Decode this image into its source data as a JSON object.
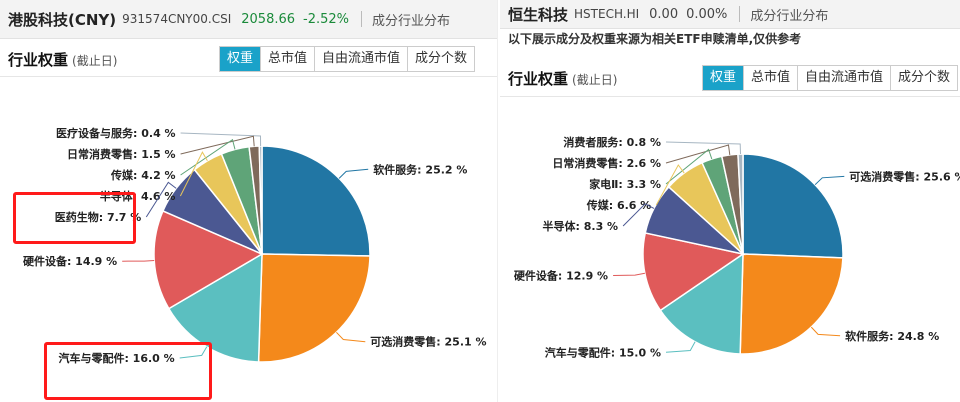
{
  "colors": {
    "palette": [
      "#2176a4",
      "#f4891b",
      "#5bbfc0",
      "#e05a5a",
      "#4b5892",
      "#e8c65a",
      "#5fa478",
      "#7f6a5b",
      "#a7b6c2"
    ],
    "active_tab": "#1aa2c9",
    "highlight": "#ff1a1a"
  },
  "left": {
    "index_name": "港股科技(CNY)",
    "index_code": "931574CNY00.CSI",
    "price": "2058.66",
    "change": "-2.52%",
    "dist_label": "成分行业分布",
    "section_title": "行业权重",
    "section_sub": "(截止日)",
    "tabs": [
      "权重",
      "总市值",
      "自由流通市值",
      "成分个数"
    ],
    "active_tab": 0
  },
  "right": {
    "index_name": "恒生科技",
    "index_code": "HSTECH.HI",
    "price": "0.00",
    "change": "0.00%",
    "dist_label": "成分行业分布",
    "notice": "以下展示成分及权重来源为相关ETF申赎清单,仅供参考",
    "section_title": "行业权重",
    "section_sub": "(截止日)",
    "tabs": [
      "权重",
      "总市值",
      "自由流通市值",
      "成分个数"
    ],
    "active_tab": 0
  },
  "chart_data": [
    {
      "type": "pie",
      "categories": [
        "软件服务",
        "可选消费零售",
        "汽车与零配件",
        "硬件设备",
        "医药生物",
        "半导体",
        "传媒",
        "日常消费零售",
        "医疗设备与服务"
      ],
      "values": [
        25.2,
        25.1,
        16.0,
        14.9,
        7.7,
        4.6,
        4.2,
        1.5,
        0.4
      ],
      "labels": [
        "软件服务: 25.2 %",
        "可选消费零售: 25.1 %",
        "汽车与零配件: 16.0 %",
        "硬件设备: 14.9 %",
        "医药生物: 7.7 %",
        "半导体: 4.6 %",
        "传媒: 4.2 %",
        "日常消费零售: 1.5 %",
        "医疗设备与服务: 0.4 %"
      ],
      "highlighted": [
        "汽车与零配件",
        "医药生物"
      ]
    },
    {
      "type": "pie",
      "categories": [
        "可选消费零售",
        "软件服务",
        "汽车与零配件",
        "硬件设备",
        "半导体",
        "传媒",
        "家电Ⅱ",
        "日常消费零售",
        "消费者服务"
      ],
      "values": [
        25.6,
        24.8,
        15.0,
        12.9,
        8.3,
        6.6,
        3.3,
        2.6,
        0.8
      ],
      "labels": [
        "可选消费零售: 25.6 %",
        "软件服务: 24.8 %",
        "汽车与零配件: 15.0 %",
        "硬件设备: 12.9 %",
        "半导体: 8.3 %",
        "传媒: 6.6 %",
        "家电Ⅱ: 3.3 %",
        "日常消费零售: 2.6 %",
        "消费者服务: 0.8 %"
      ]
    }
  ]
}
